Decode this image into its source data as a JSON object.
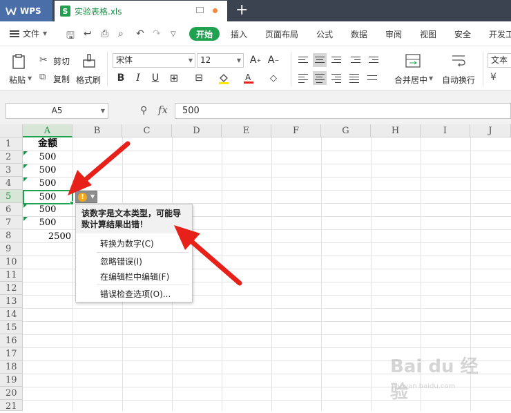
{
  "titlebar": {
    "app_label": "WPS",
    "doc_icon": "S",
    "doc_name": "实验表格.xls",
    "new_tab": "+"
  },
  "menubar": {
    "file": "文件",
    "items": [
      "开始",
      "插入",
      "页面布局",
      "公式",
      "数据",
      "审阅",
      "视图",
      "安全",
      "开发工"
    ]
  },
  "ribbon": {
    "paste": "粘贴",
    "cut": "剪切",
    "copy": "复制",
    "format_painter": "格式刷",
    "font_name": "宋体",
    "font_size": "12",
    "merge_center": "合并居中",
    "wrap_text": "自动换行",
    "number_format": "文本"
  },
  "formula_bar": {
    "name_box": "A5",
    "fx": "fx",
    "value": "500"
  },
  "sheet": {
    "columns": [
      "A",
      "B",
      "C",
      "D",
      "E",
      "F",
      "G",
      "H",
      "I",
      "J"
    ],
    "rows": [
      "1",
      "2",
      "3",
      "4",
      "5",
      "6",
      "7",
      "8",
      "9",
      "10",
      "11",
      "12",
      "13",
      "14",
      "15",
      "16",
      "17",
      "18",
      "19",
      "20",
      "21"
    ],
    "cells": {
      "A1": "金额",
      "A2": "500",
      "A3": "500",
      "A4": "500",
      "A5": "500",
      "A6": "500",
      "A7": "500",
      "A8": "2500"
    },
    "active_cell": "A5"
  },
  "error_popup": {
    "message_line1": "该数字是文本类型，可能导",
    "message_line2": "致计算结果出错！",
    "options": [
      "转换为数字(C)",
      "忽略错误(I)",
      "在编辑栏中编辑(F)",
      "错误检查选项(O)..."
    ]
  },
  "watermark": {
    "brand": "Bai du 经验",
    "url": "jingyan.baidu.com"
  },
  "colors": {
    "accent_green": "#1fa14f",
    "arrow_red": "#e8201a",
    "warning_orange": "#f0a818"
  }
}
